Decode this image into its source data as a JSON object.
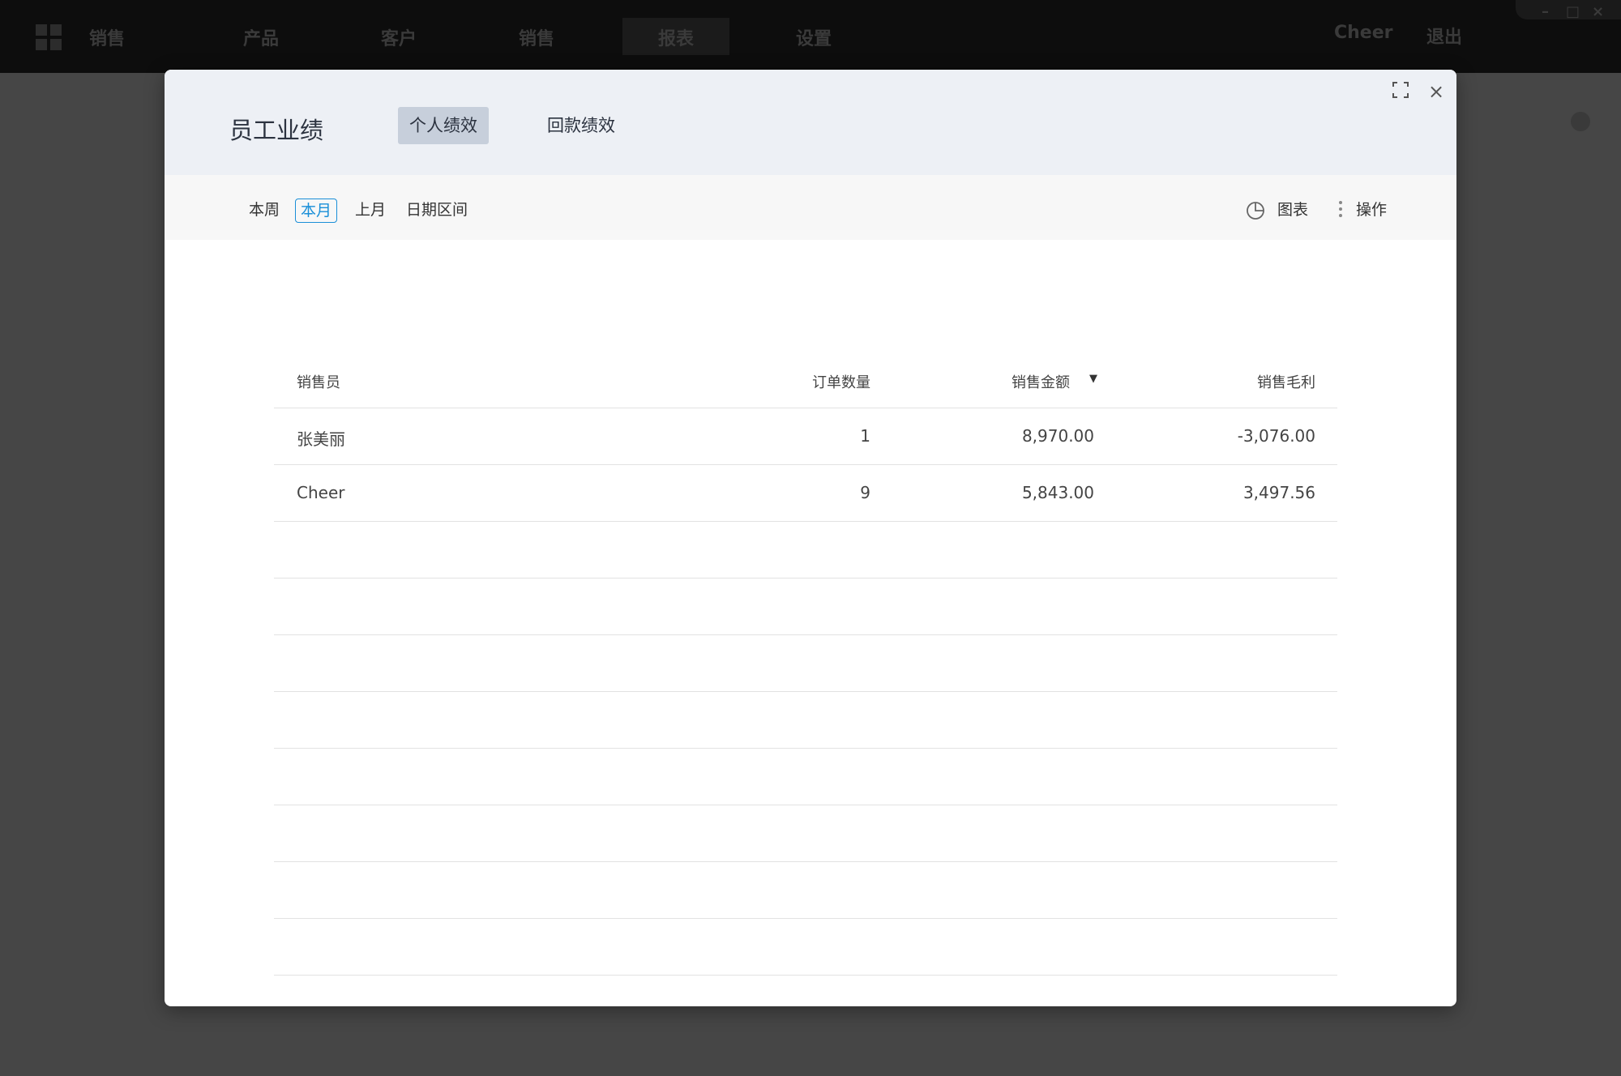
{
  "topbar": {
    "app_name": "销售",
    "nav": [
      {
        "label": "产品"
      },
      {
        "label": "客户"
      },
      {
        "label": "销售"
      },
      {
        "label": "报表"
      },
      {
        "label": "设置"
      }
    ],
    "user": "Cheer",
    "logout": "退出"
  },
  "window_controls": {
    "minimize": "–",
    "maximize": "□",
    "close": "×"
  },
  "modal": {
    "title": "员工业绩",
    "tabs": [
      {
        "label": "个人绩效",
        "active": true
      },
      {
        "label": "回款绩效",
        "active": false
      }
    ],
    "close_symbol": "×"
  },
  "filters": {
    "ranges": [
      {
        "label": "本周",
        "active": false
      },
      {
        "label": "本月",
        "active": true
      },
      {
        "label": "上月",
        "active": false
      },
      {
        "label": "日期区间",
        "active": false
      }
    ],
    "chart_label": "图表",
    "actions_label": "操作"
  },
  "table": {
    "columns": [
      "销售员",
      "订单数量",
      "销售金额",
      "销售毛利"
    ],
    "sort_indicator": "▼",
    "rows": [
      {
        "name": "张美丽",
        "orders": "1",
        "amount": "8,970.00",
        "profit": "-3,076.00"
      },
      {
        "name": "Cheer",
        "orders": "9",
        "amount": "5,843.00",
        "profit": "3,497.56"
      }
    ]
  },
  "colors": {
    "accent": "#1a8fd8",
    "header_bg": "#edf0f5",
    "active_tab_bg": "#c7cfdb",
    "overlay": "#464646"
  }
}
